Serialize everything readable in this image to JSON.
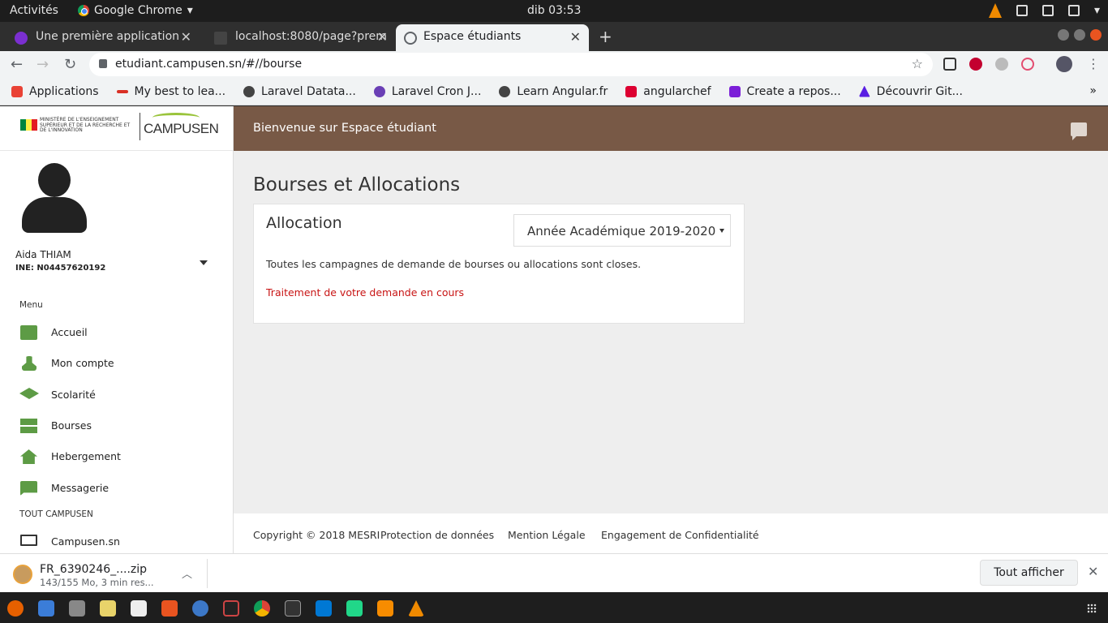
{
  "os_topbar": {
    "activities": "Activités",
    "app_name": "Google Chrome",
    "clock": "dib 03:53"
  },
  "browser": {
    "tabs": [
      {
        "title": "Une première application",
        "icon_color": "#7b2fd0"
      },
      {
        "title": "localhost:8080/page?prem",
        "icon_color": "#444444"
      },
      {
        "title": "Espace étudiants",
        "icon_color": "#5f6368"
      }
    ],
    "url": "etudiant.campusen.sn/#//bourse",
    "bookmarks": [
      {
        "label": "Applications",
        "icon": "apps-grid-icon",
        "color": "#e94235"
      },
      {
        "label": "My best to lea...",
        "icon": "bookmark-icon",
        "color": "#d93025"
      },
      {
        "label": "Laravel Datata...",
        "icon": "globe-icon",
        "color": "#444444"
      },
      {
        "label": "Laravel Cron J...",
        "icon": "cloud-icon",
        "color": "#6a3fb5"
      },
      {
        "label": "Learn Angular.fr",
        "icon": "globe-icon",
        "color": "#444444"
      },
      {
        "label": "angularchef",
        "icon": "angular-icon",
        "color": "#dd0031"
      },
      {
        "label": "Create a repos...",
        "icon": "bookmark-icon",
        "color": "#7b1fd8"
      },
      {
        "label": "Découvrir Git...",
        "icon": "triangle-icon",
        "color": "#5a1ee3"
      }
    ]
  },
  "logo": {
    "ministry_text": "MINISTÈRE DE L'ENSEIGNEMENT SUPÉRIEUR ET DE LA RECHERCHE ET DE L'INNOVATION",
    "brand": "CAMPUSEN"
  },
  "user": {
    "name": "Aida THIAM",
    "ine": "INE: N04457620192"
  },
  "sidebar": {
    "menu_label": "Menu",
    "items": [
      {
        "label": "Accueil",
        "icon": "folder-icon"
      },
      {
        "label": "Mon compte",
        "icon": "person-icon"
      },
      {
        "label": "Scolarité",
        "icon": "graduation-cap-icon"
      },
      {
        "label": "Bourses",
        "icon": "server-icon"
      },
      {
        "label": "Hebergement",
        "icon": "home-icon"
      },
      {
        "label": "Messagerie",
        "icon": "message-icon"
      }
    ],
    "section2_label": "TOUT CAMPUSEN",
    "items2": [
      {
        "label": "Campusen.sn",
        "icon": "laptop-icon"
      }
    ]
  },
  "header": {
    "welcome": "Bienvenue sur Espace étudiant",
    "color": "#785946"
  },
  "main": {
    "title": "Bourses et Allocations",
    "card": {
      "title": "Allocation",
      "year_select": "Année Académique 2019-2020",
      "message": "Toutes les campagnes de demande de bourses ou allocations sont closes.",
      "status": "Traitement de votre demande en cours",
      "status_color": "#c81414"
    }
  },
  "footer": {
    "copyright": "Copyright © 2018 MESRI",
    "links": [
      "Protection de données",
      "Mention Légale",
      "Engagement de Confidentialité"
    ]
  },
  "downloads": {
    "file_name": "FR_6390246_....zip",
    "status": "143/155 Mo, 3 min res...",
    "show_all": "Tout afficher"
  }
}
